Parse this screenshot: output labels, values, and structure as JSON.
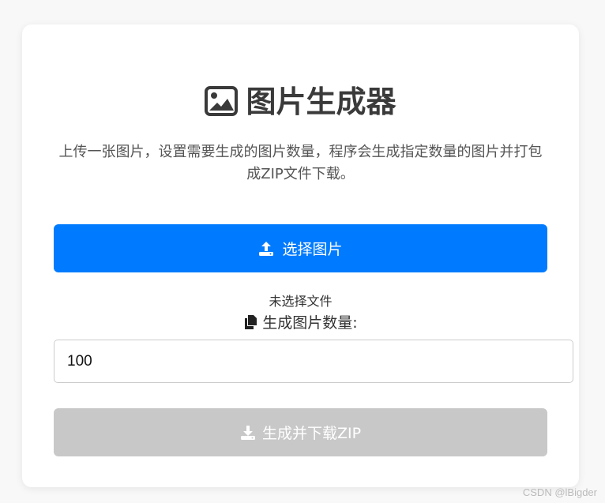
{
  "app": {
    "title": "图片生成器",
    "description": "上传一张图片，设置需要生成的图片数量，程序会生成指定数量的图片并打包成ZIP文件下载。"
  },
  "upload": {
    "button_label": "选择图片",
    "file_status": "未选择文件"
  },
  "count": {
    "label": "生成图片数量:",
    "value": "100"
  },
  "download": {
    "button_label": "生成并下载ZIP",
    "disabled": true
  },
  "watermark": "CSDN @lBigder",
  "colors": {
    "primary": "#007bff",
    "disabled": "#c8c8c8",
    "title": "#3a3a3a"
  },
  "icons": {
    "title": "image-icon",
    "upload": "upload-icon",
    "count": "copy-icon",
    "download": "download-icon"
  }
}
